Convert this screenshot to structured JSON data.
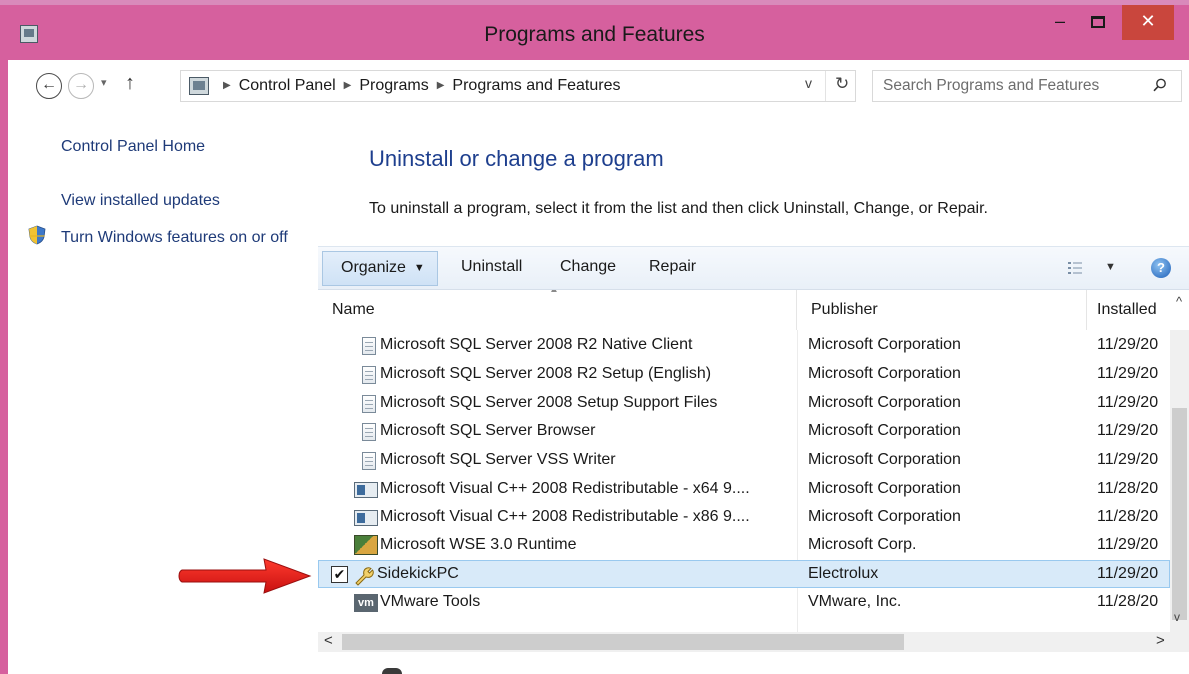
{
  "window": {
    "title": "Programs and Features",
    "minimize_glyph": "–",
    "close_glyph": "✕"
  },
  "nav": {
    "back_glyph": "←",
    "forward_glyph": "→",
    "recent_glyph": "▾",
    "up_glyph": "↑",
    "breadcrumbs": [
      "Control Panel",
      "Programs",
      "Programs and Features"
    ],
    "refresh_glyph": "↻",
    "dropdown_glyph": "v"
  },
  "search": {
    "placeholder": "Search Programs and Features"
  },
  "sidebar": {
    "items": [
      {
        "label": "Control Panel Home"
      },
      {
        "label": "View installed updates"
      },
      {
        "label": "Turn Windows features on or off",
        "icon": "uac-shield-icon"
      }
    ]
  },
  "main": {
    "title": "Uninstall or change a program",
    "description": "To uninstall a program, select it from the list and then click Uninstall, Change, or Repair."
  },
  "toolbar": {
    "organize_label": "Organize",
    "uninstall_label": "Uninstall",
    "change_label": "Change",
    "repair_label": "Repair",
    "help_glyph": "?"
  },
  "list": {
    "columns": [
      "Name",
      "Publisher",
      "Installed"
    ],
    "rows": [
      {
        "name": "Microsoft SQL Server 2008 R2 Native Client",
        "publisher": "Microsoft Corporation",
        "installed": "11/29/20",
        "icon": "installer-doc-icon"
      },
      {
        "name": "Microsoft SQL Server 2008 R2 Setup (English)",
        "publisher": "Microsoft Corporation",
        "installed": "11/29/20",
        "icon": "installer-doc-icon"
      },
      {
        "name": "Microsoft SQL Server 2008 Setup Support Files",
        "publisher": "Microsoft Corporation",
        "installed": "11/29/20",
        "icon": "installer-doc-icon"
      },
      {
        "name": "Microsoft SQL Server Browser",
        "publisher": "Microsoft Corporation",
        "installed": "11/29/20",
        "icon": "installer-doc-icon"
      },
      {
        "name": "Microsoft SQL Server VSS Writer",
        "publisher": "Microsoft Corporation",
        "installed": "11/29/20",
        "icon": "installer-doc-icon"
      },
      {
        "name": "Microsoft Visual C++ 2008 Redistributable - x64 9....",
        "publisher": "Microsoft Corporation",
        "installed": "11/28/20",
        "icon": "program-window-icon"
      },
      {
        "name": "Microsoft Visual C++ 2008 Redistributable - x86 9....",
        "publisher": "Microsoft Corporation",
        "installed": "11/28/20",
        "icon": "program-window-icon"
      },
      {
        "name": "Microsoft WSE 3.0 Runtime",
        "publisher": "Microsoft Corp.",
        "installed": "11/29/20",
        "icon": "wse-runtime-icon"
      },
      {
        "name": "SidekickPC",
        "publisher": "Electrolux",
        "installed": "11/29/20",
        "icon": "wrench-icon",
        "selected": true,
        "checked": true
      },
      {
        "name": "VMware Tools",
        "publisher": "VMware, Inc.",
        "installed": "11/28/20",
        "icon": "vmware-icon",
        "icon_text": "vm"
      }
    ],
    "check_glyph": "✔"
  },
  "colors": {
    "titlebar": "#d6609e",
    "close_button": "#c9463d",
    "link": "#1e3a78",
    "heading": "#1e3f8e",
    "selection": "#d8eaf9",
    "arrow": "#e02020"
  }
}
